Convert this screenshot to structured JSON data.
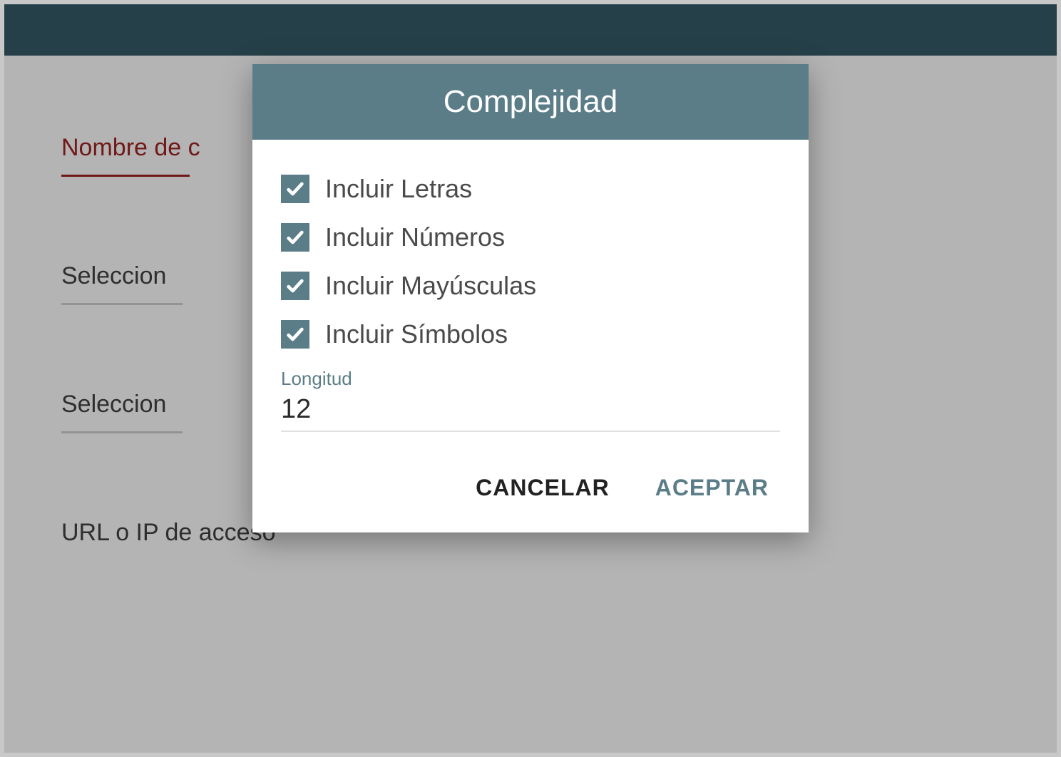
{
  "colors": {
    "topbar": "#30505c",
    "dialogHeader": "#5b7d88",
    "accent": "#5b7d88",
    "error": "#8e1f1f"
  },
  "background": {
    "fields": [
      {
        "label": "Nombre de c",
        "error": true
      },
      {
        "label": "Seleccion",
        "error": false
      },
      {
        "label": "Seleccion",
        "error": false
      },
      {
        "label": "URL o IP de acceso",
        "error": false
      }
    ]
  },
  "dialog": {
    "title": "Complejidad",
    "checks": [
      {
        "label": "Incluir Letras",
        "checked": true
      },
      {
        "label": "Incluir Números",
        "checked": true
      },
      {
        "label": "Incluir Mayúsculas",
        "checked": true
      },
      {
        "label": "Incluir Símbolos",
        "checked": true
      }
    ],
    "length": {
      "label": "Longitud",
      "value": "12"
    },
    "actions": {
      "cancel": "CANCELAR",
      "accept": "ACEPTAR"
    }
  }
}
